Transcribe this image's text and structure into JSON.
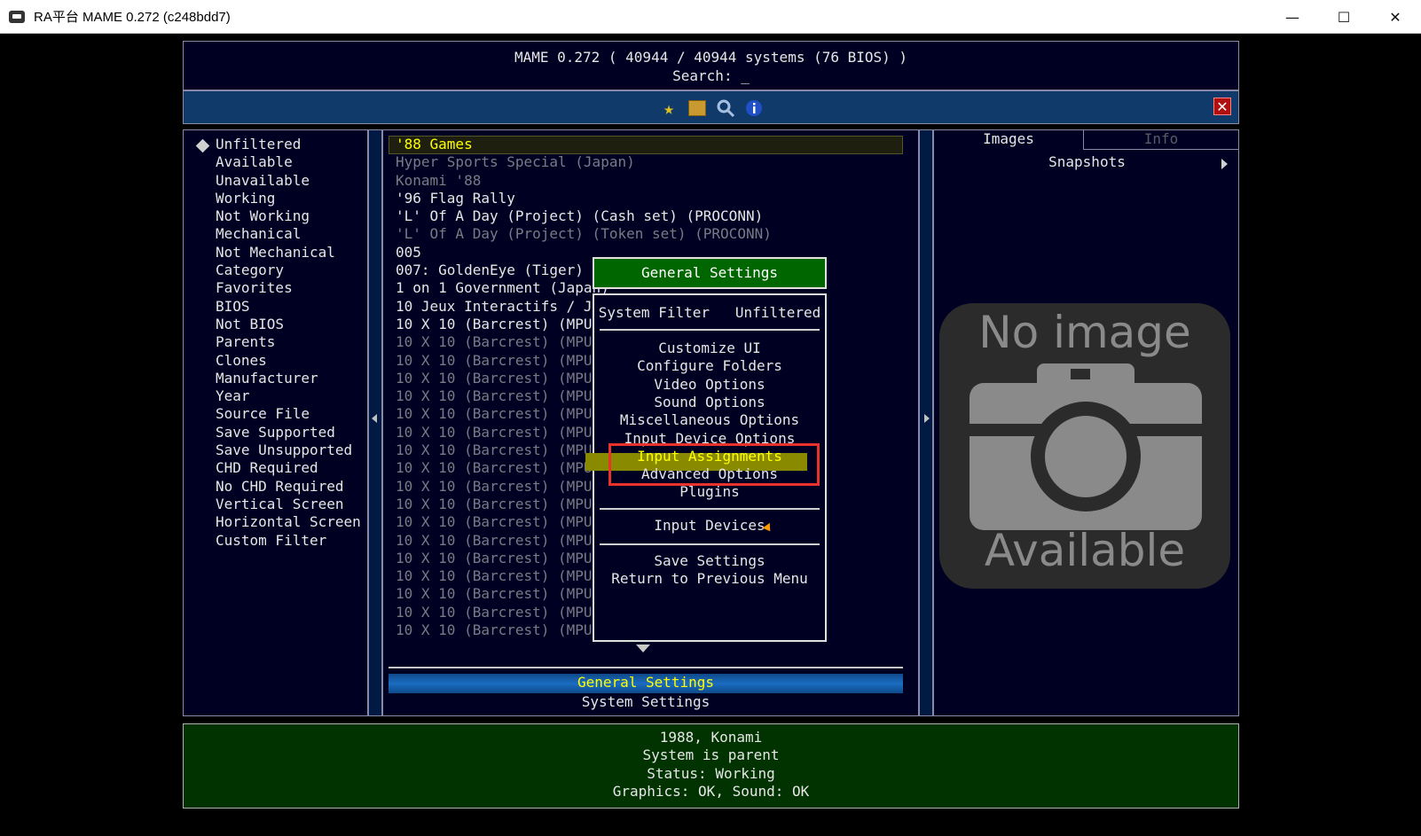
{
  "window": {
    "title": "RA平台 MAME 0.272 (c248bdd7)",
    "minimize": "—",
    "maximize": "☐",
    "close": "✕"
  },
  "header": {
    "line1": "MAME 0.272 ( 40944 / 40944 systems (76 BIOS) )",
    "line2": "Search: _"
  },
  "toolbar": {
    "icons": [
      "star-icon",
      "save-icon",
      "search-icon",
      "info-icon"
    ],
    "close_label": "✕"
  },
  "filters": [
    "Unfiltered",
    "Available",
    "Unavailable",
    "Working",
    "Not Working",
    "Mechanical",
    "Not Mechanical",
    "Category",
    "Favorites",
    "BIOS",
    "Not BIOS",
    "Parents",
    "Clones",
    "Manufacturer",
    "Year",
    "Source File",
    "Save Supported",
    "Save Unsupported",
    "CHD Required",
    "No CHD Required",
    "Vertical Screen",
    "Horizontal Screen",
    "Custom Filter"
  ],
  "games": [
    {
      "name": "'88 Games",
      "style": "yellow"
    },
    {
      "name": "Hyper Sports Special (Japan)",
      "style": "dim"
    },
    {
      "name": "Konami '88",
      "style": "dim"
    },
    {
      "name": "'96 Flag Rally",
      "style": ""
    },
    {
      "name": "'L' Of A Day (Project) (Cash set) (PROCONN)",
      "style": ""
    },
    {
      "name": "'L' Of A Day (Project) (Token set) (PROCONN)",
      "style": "dim"
    },
    {
      "name": "005",
      "style": ""
    },
    {
      "name": "007: GoldenEye (Tiger)",
      "style": ""
    },
    {
      "name": "1 on 1 Government (Japan)",
      "style": ""
    },
    {
      "name": "10 Jeux Interactifs / Jeux",
      "style": ""
    },
    {
      "name": "10 X 10 (Barcrest) (MPU4",
      "style": ""
    },
    {
      "name": "10 X 10 (Barcrest) (MPU4",
      "style": "dim"
    },
    {
      "name": "10 X 10 (Barcrest) (MPU4",
      "style": "dim"
    },
    {
      "name": "10 X 10 (Barcrest) (MPU4",
      "style": "dim"
    },
    {
      "name": "10 X 10 (Barcrest) (MPU4",
      "style": "dim"
    },
    {
      "name": "10 X 10 (Barcrest) (MPU4",
      "style": "dim"
    },
    {
      "name": "10 X 10 (Barcrest) (MPU4",
      "style": "dim"
    },
    {
      "name": "10 X 10 (Barcrest) (MPU4",
      "style": "dim"
    },
    {
      "name": "10 X 10 (Barcrest) (MPU4",
      "style": "dim"
    },
    {
      "name": "10 X 10 (Barcrest) (MPU4",
      "style": "dim"
    },
    {
      "name": "10 X 10 (Barcrest) (MPU4",
      "style": "dim"
    },
    {
      "name": "10 X 10 (Barcrest) (MPU4",
      "style": "dim"
    },
    {
      "name": "10 X 10 (Barcrest) (MPU4",
      "style": "dim"
    },
    {
      "name": "10 X 10 (Barcrest) (MPU4",
      "style": "dim"
    },
    {
      "name": "10 X 10 (Barcrest) (MPU4",
      "style": "dim"
    },
    {
      "name": "10 X 10 (Barcrest) (MPU4",
      "style": "dim"
    },
    {
      "name": "10 X 10 (Barcrest) (MPU4) (T20 0.2 DY)",
      "style": "dim"
    },
    {
      "name": "10 X 10 (Barcrest) (MPU4) (T20 0.2 K)",
      "style": "dim"
    }
  ],
  "list_footer": {
    "selected": "General Settings",
    "other": "System Settings"
  },
  "right": {
    "tab_images": "Images",
    "tab_info": "Info",
    "snapshots": "Snapshots",
    "noimage_line1": "No image",
    "noimage_line2": "Available"
  },
  "info": {
    "line1": "1988, Konami",
    "line2": "System is parent",
    "line3": "Status: Working",
    "line4": "Graphics: OK, Sound: OK"
  },
  "popup": {
    "title": "General Settings",
    "filter_label": "System Filter",
    "filter_value": "Unfiltered",
    "items": [
      "Customize UI",
      "Configure Folders",
      "Video Options",
      "Sound Options",
      "Miscellaneous Options",
      "Input Device Options",
      "Input Assignments",
      "Advanced Options",
      "Plugins"
    ],
    "input_devices": "Input Devices",
    "save": "Save Settings",
    "return": "Return to Previous Menu"
  }
}
